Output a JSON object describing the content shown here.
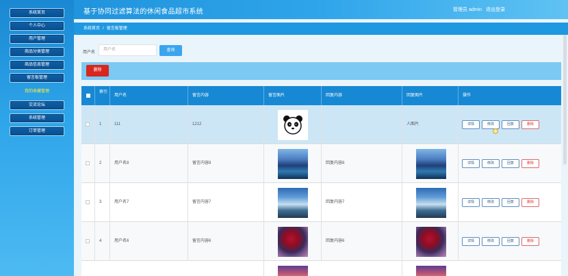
{
  "header": {
    "title": "基于协同过滤算法的休闲食品超市系统",
    "admin_label": "管理员 admin",
    "logout_label": "退出登录"
  },
  "sidebar": {
    "items": [
      {
        "label": "系统首页"
      },
      {
        "label": "个人中心"
      },
      {
        "label": "用户管理"
      },
      {
        "label": "商品分类管理"
      },
      {
        "label": "商品信息管理"
      },
      {
        "label": "留言板管理"
      }
    ],
    "active_label": "我的收藏管理",
    "items_bottom": [
      {
        "label": "交流论坛"
      },
      {
        "label": "系统管理"
      },
      {
        "label": "订单管理"
      }
    ]
  },
  "breadcrumb": {
    "home": "系统首页",
    "separator": "/",
    "current": "留言板管理"
  },
  "search": {
    "label": "用户名",
    "placeholder": "用户名",
    "button_label": "查询"
  },
  "toolbar": {
    "delete_label": "删除"
  },
  "table": {
    "headers": [
      "",
      "索引",
      "用户名",
      "留言内容",
      "留言图片",
      "回复内容",
      "回复图片",
      "操作"
    ],
    "rows": [
      {
        "index": "1",
        "username": "111",
        "content": "1212",
        "reply": "",
        "reply_image_text": "人图片",
        "image": "panda"
      },
      {
        "index": "2",
        "username": "用户名8",
        "content": "留言内容8",
        "reply": "回复内容8",
        "reply_image_text": "",
        "image": "lake"
      },
      {
        "index": "3",
        "username": "用户名7",
        "content": "留言内容7",
        "reply": "回复内容7",
        "reply_image_text": "",
        "image": "fall"
      },
      {
        "index": "4",
        "username": "用户名6",
        "content": "留言内容6",
        "reply": "回复内容6",
        "reply_image_text": "",
        "image": "tree"
      }
    ],
    "row_actions": [
      "详情",
      "修改",
      "回复",
      "删除"
    ]
  }
}
